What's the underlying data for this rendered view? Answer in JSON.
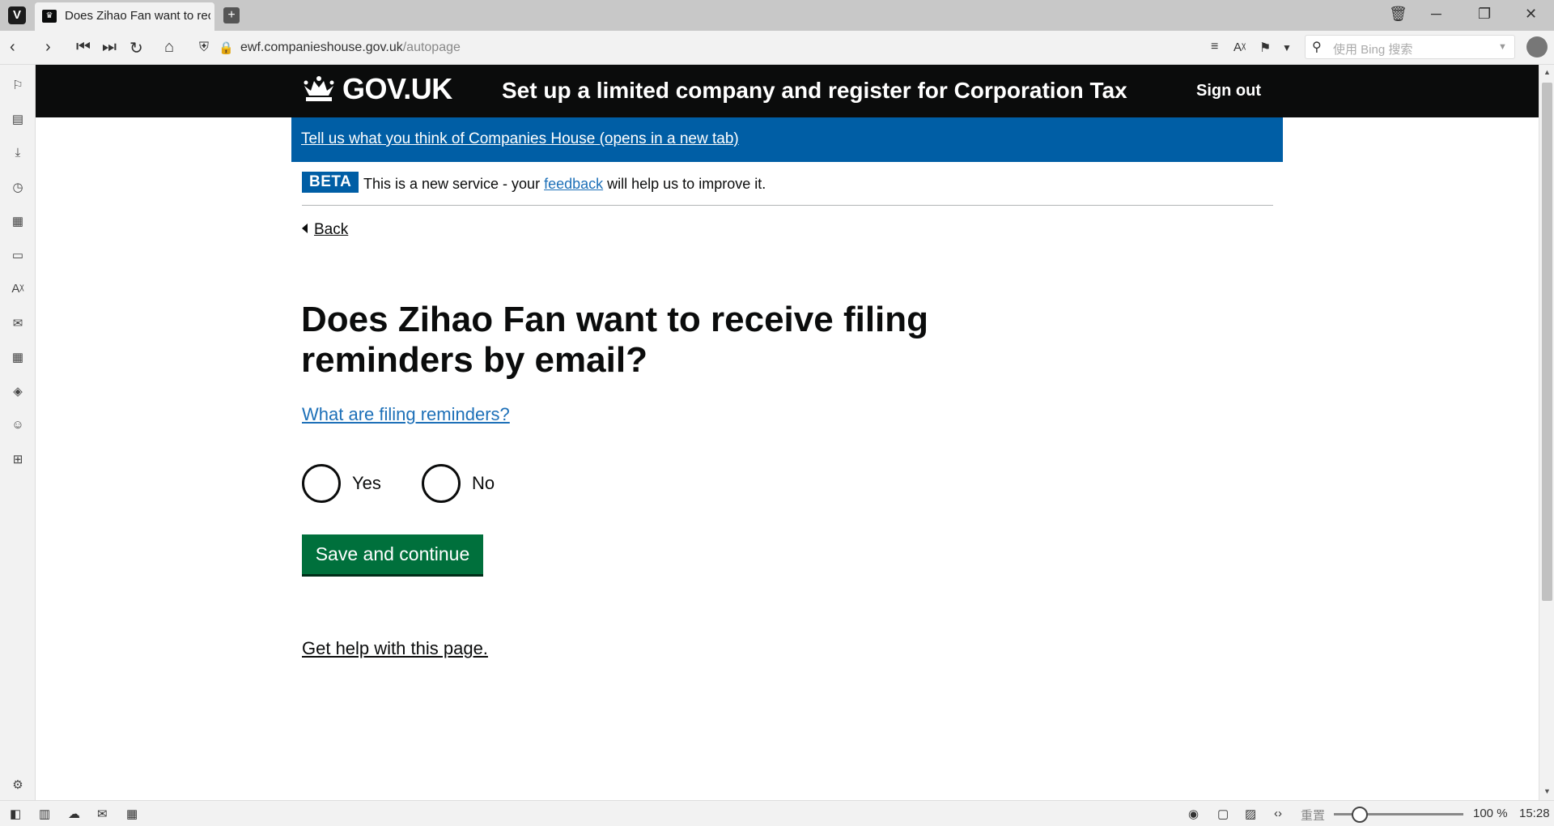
{
  "browser": {
    "tab_title": "Does Zihao Fan want to rec",
    "url_domain": "ewf.companieshouse.gov.uk",
    "url_path": "/autopage",
    "search_placeholder": "使用 Bing 搜索",
    "zoom_reset": "重置",
    "zoom_level": "100 %",
    "clock": "15:28"
  },
  "header": {
    "brand": "GOV.UK",
    "service_name": "Set up a limited company and register for Corporation Tax",
    "sign_out": "Sign out"
  },
  "feedback_banner": {
    "link": "Tell us what you think of Companies House (opens in a new tab)"
  },
  "phase_banner": {
    "tag": "BETA",
    "text_before": "This is a new service - your ",
    "link": "feedback",
    "text_after": " will help us to improve it."
  },
  "back_link": "Back",
  "question": "Does Zihao Fan want to receive filing reminders by email?",
  "help_link": "What are filing reminders?",
  "options": [
    {
      "label": "Yes"
    },
    {
      "label": "No"
    }
  ],
  "submit": "Save and continue",
  "get_help": "Get help with this page."
}
